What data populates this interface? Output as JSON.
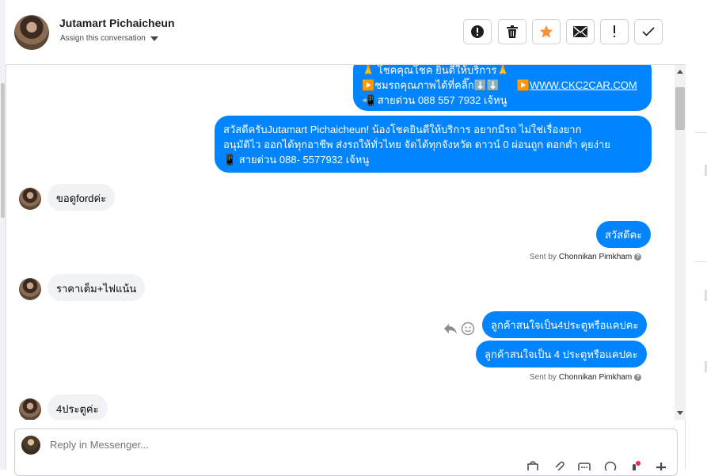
{
  "header": {
    "name": "Jutamart Pichaicheun",
    "assign_label": "Assign this conversation",
    "buttons": [
      "alert-icon",
      "trash-icon",
      "star-icon",
      "mail-icon",
      "exclamation-icon",
      "check-icon"
    ],
    "star_color": "#f7923a"
  },
  "messages": {
    "m1": {
      "line1": "🙏 โชคคุณโชค ยินดีให้บริการ🙏",
      "line2a": "▶️ชมรถคุณภาพได้ที่คลิ๊ก⬇️⬇️",
      "line2b": "▶️",
      "link": "WWW.CKC2CAR.COM",
      "line3": "📲 สายด่วน 088 557 7932 เจ้หนู"
    },
    "m2": {
      "line1": "สวัสดีครับJutamart Pichaicheun! น้องโชคยินดีให้บริการ อยากมีรถ ไม่ใช่เรื่องยาก",
      "line2": "อนุมัติไว ออกได้ทุกอาชีพ ส่งรถให้ทั่วไทย จัดได้ทุกจังหวัด ดาวน์ 0  ผ่อนถูก ดอกต่ำ คุยง่าย",
      "line3": "📱 สายด่วน 088- 5577932 เจ้หนู"
    },
    "in1": "ขอดูfordค่ะ",
    "out1": "สวัสดีคะ",
    "sent_by_prefix": "Sent by",
    "sent_by_name": "Chonnikan Pimkham",
    "in2": "ราคาเต็ม+ไฟแน้น",
    "out2": "ลูกค้าสนใจเป็น4ประตูหรือแคปคะ",
    "out3": "ลูกค้าสนใจเป็น 4 ประตูหรือแคปคะ",
    "in3": "4ประตูค่ะ"
  },
  "reply": {
    "placeholder": "Reply in Messenger..."
  },
  "colors": {
    "outgoing_bubble": "#0084ff",
    "incoming_bubble": "#f0f2f5"
  }
}
